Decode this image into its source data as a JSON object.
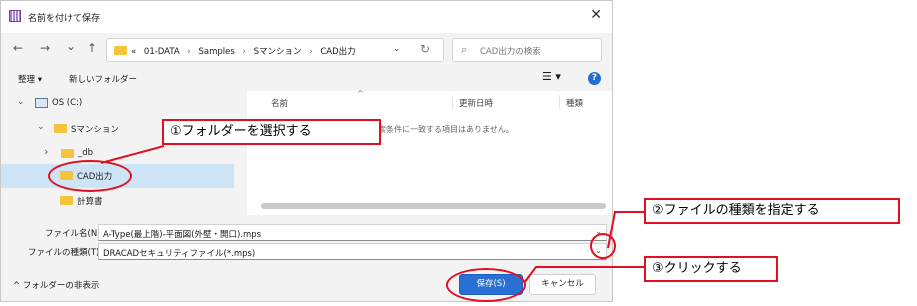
{
  "window": {
    "title": "名前を付けて保存",
    "close_glyph": "✕"
  },
  "nav": {
    "back_glyph": "←",
    "forward_glyph": "→",
    "recent_glyph": "⌄",
    "up_glyph": "↑",
    "path": [
      "«",
      "01-DATA",
      "Samples",
      "Sマンション",
      "CAD出力"
    ],
    "path_chevron": "⌄",
    "refresh_glyph": "↻",
    "search_placeholder": "CAD出力の検索"
  },
  "toolbar": {
    "organize": "整理 ▾",
    "new_folder": "新しいフォルダー",
    "view_glyph": "☰ ▾",
    "help_glyph": "?"
  },
  "tree": [
    {
      "chevron": "⌄",
      "label": "OS (C:)",
      "kind": "drive",
      "selected": false
    },
    {
      "chevron": "⌄",
      "label": "Sマンション",
      "kind": "folder",
      "selected": false
    },
    {
      "chevron": "›",
      "label": "_db",
      "kind": "folder",
      "selected": false
    },
    {
      "chevron": "",
      "label": "CAD出力",
      "kind": "folder",
      "selected": true
    },
    {
      "chevron": "",
      "label": "計算書",
      "kind": "folder",
      "selected": false
    }
  ],
  "file_list": {
    "columns": [
      "名前",
      "更新日時",
      "種類"
    ],
    "sort_glyph": "^",
    "empty_message": "検索条件に一致する項目はありません。"
  },
  "form": {
    "filename_label": "ファイル名(N):",
    "filename_value": "A-Type(最上階)-平面図(外壁・開口).mps",
    "filetype_label": "ファイルの種類(T):",
    "filetype_value": "DRACADセキュリティファイル(*.mps)",
    "chevron": "⌄"
  },
  "footer": {
    "hide_folders": "^  フォルダーの非表示",
    "save_label": "保存(S)",
    "cancel_label": "キャンセル"
  },
  "callouts": {
    "step1": "①フォルダーを選択する",
    "step2": "②ファイルの種類を指定する",
    "step3": "③クリックする"
  },
  "colors": {
    "accent": "#2a6fd3",
    "annotation": "#e01020",
    "selection": "#cde4f7",
    "folder": "#f4c43c"
  }
}
